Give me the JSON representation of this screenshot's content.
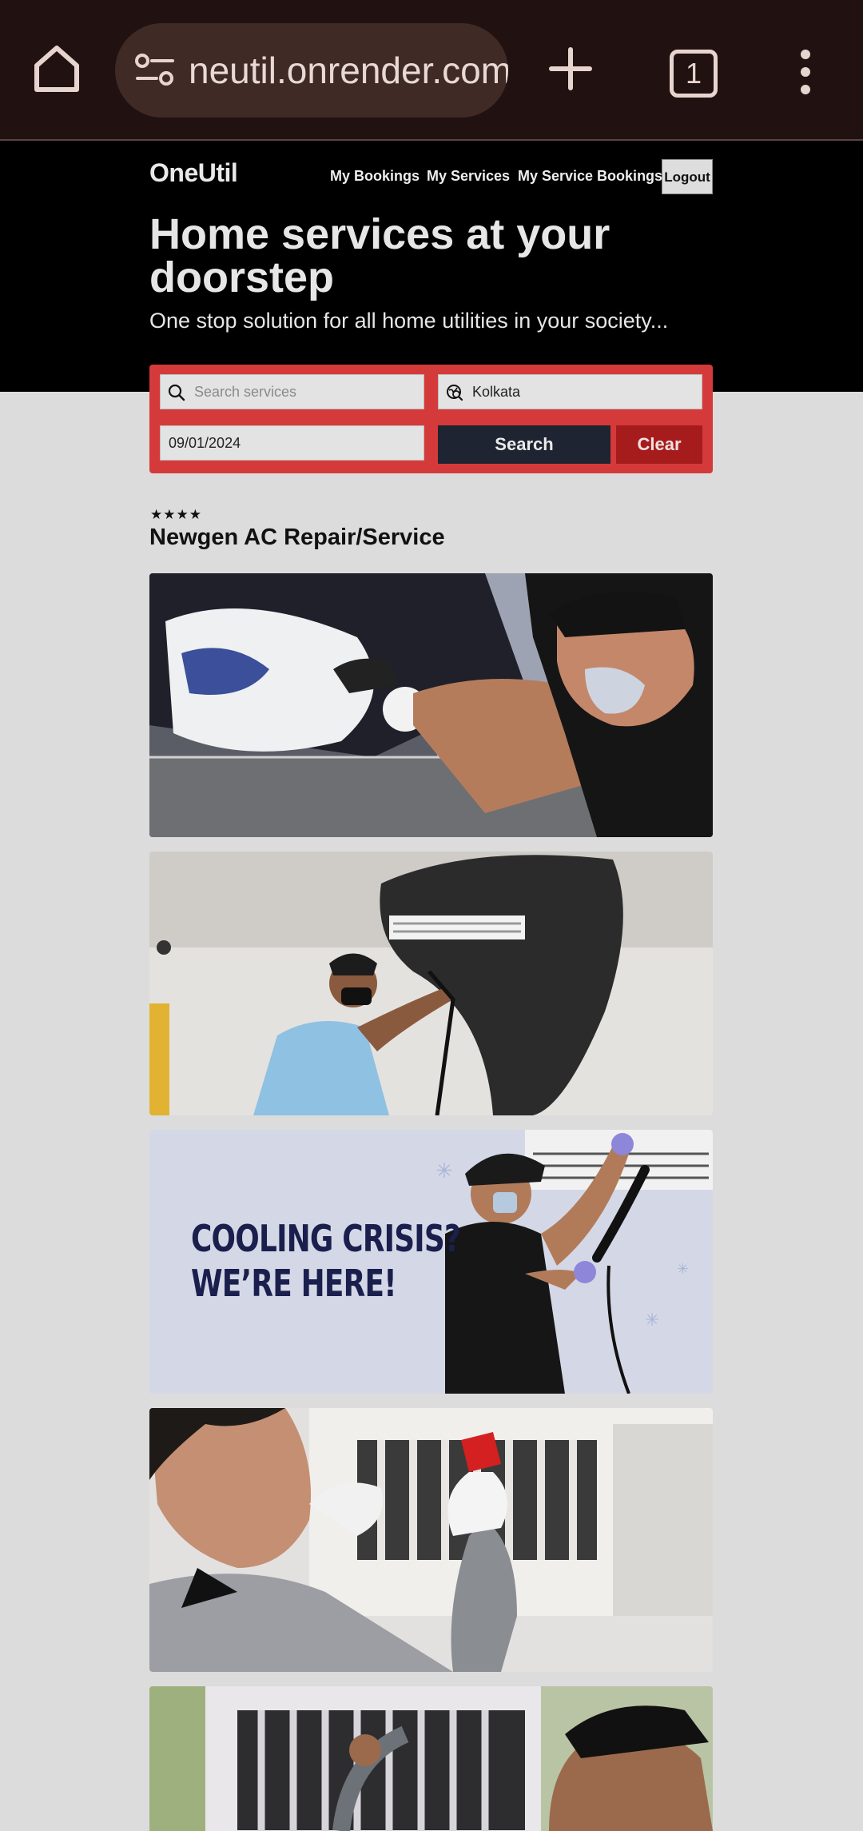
{
  "browser": {
    "url": "neutil.onrender.com",
    "tab_count": "1"
  },
  "site": {
    "logo": "OneUtil",
    "nav": [
      "My Bookings",
      "My Services",
      "My Service Bookings"
    ],
    "logout_label": "Logout",
    "hero_title": "Home services at your doorstep",
    "hero_subtitle": "One stop solution for all home utilities in your society..."
  },
  "search": {
    "services_placeholder": "Search services",
    "location_value": "Kolkata",
    "date_value": "09/01/2024",
    "search_label": "Search",
    "clear_label": "Clear"
  },
  "service": {
    "rating_stars": "★★★★",
    "rating": 4,
    "title": "Newgen AC Repair/Service",
    "banner_line1": "COOLING CRISIS?",
    "banner_line2": "WE’RE HERE!"
  },
  "colors": {
    "browser_bg": "#211211",
    "hero_bg": "#000000",
    "panel_red": "#d53a3a",
    "search_btn": "#1e2431",
    "clear_btn": "#a61c1c",
    "page_bg": "#dcdcdc"
  }
}
